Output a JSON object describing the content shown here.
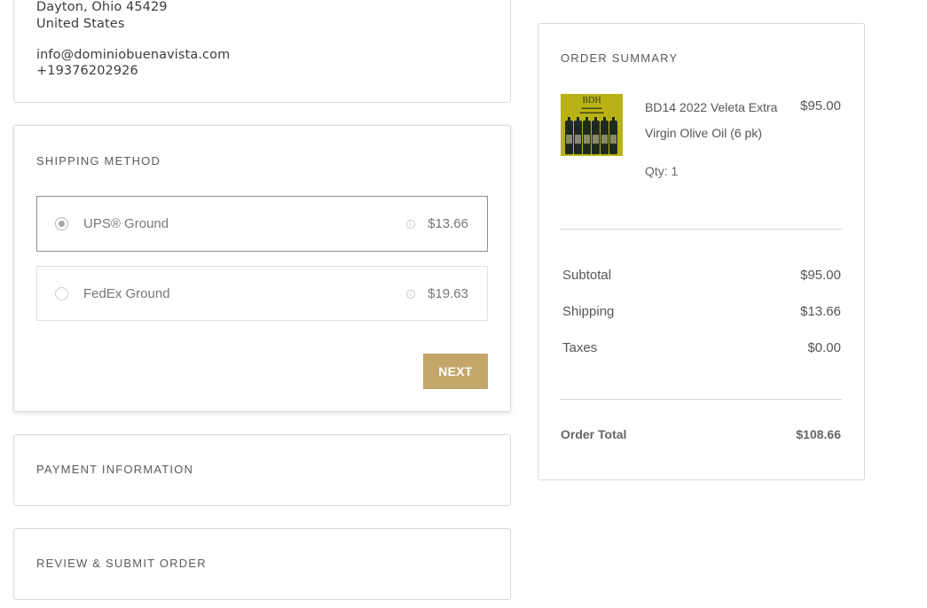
{
  "contact": {
    "address_line": "Dayton, Ohio 45429",
    "country": "United States",
    "email": "info@dominiobuenavista.com",
    "phone": "+19376202926"
  },
  "shipping": {
    "title": "SHIPPING METHOD",
    "options": [
      {
        "label": "UPS® Ground",
        "price": "$13.66",
        "selected": true
      },
      {
        "label": "FedEx Ground",
        "price": "$19.63",
        "selected": false
      }
    ],
    "info_icon": "info-icon",
    "next_label": "NEXT"
  },
  "payment": {
    "title": "PAYMENT INFORMATION"
  },
  "review": {
    "title": "REVIEW & SUBMIT ORDER"
  },
  "summary": {
    "title": "ORDER SUMMARY",
    "item": {
      "thumb_brand": "BDH",
      "name": "BD14 2022 Veleta Extra Virgin Olive Oil (6 pk)",
      "price": "$95.00",
      "qty": "Qty: 1"
    },
    "subtotal_label": "Subtotal",
    "subtotal": "$95.00",
    "shipping_label": "Shipping",
    "shipping": "$13.66",
    "taxes_label": "Taxes",
    "taxes": "$0.00",
    "total_label": "Order Total",
    "total": "$108.66"
  },
  "colors": {
    "accent": "#c4a56a",
    "border": "#d9d9d9",
    "text": "#4a4a4a"
  }
}
